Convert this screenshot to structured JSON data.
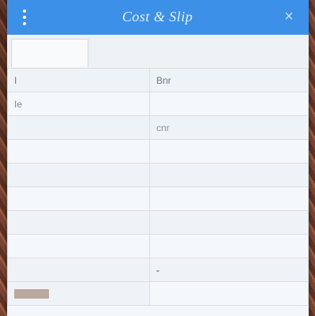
{
  "window": {
    "title": "Cost & Slip",
    "close_glyph": "×"
  },
  "tabs": [
    {
      "label": ""
    },
    {
      "label": ""
    }
  ],
  "rows": [
    {
      "key": "I",
      "value": "Bnr"
    },
    {
      "key": "Ie",
      "value": ""
    },
    {
      "key": "",
      "value": "cnr"
    },
    {
      "key": "",
      "value": ""
    },
    {
      "key": "",
      "value": ""
    },
    {
      "key": "",
      "value": ""
    },
    {
      "key": "",
      "value": ""
    },
    {
      "key": "",
      "value": ""
    },
    {
      "key": "",
      "value": "-"
    },
    {
      "key": "",
      "value": ""
    }
  ],
  "colors": {
    "header_bg": "#3d90e8",
    "panel_bg": "#f3f6fa"
  }
}
